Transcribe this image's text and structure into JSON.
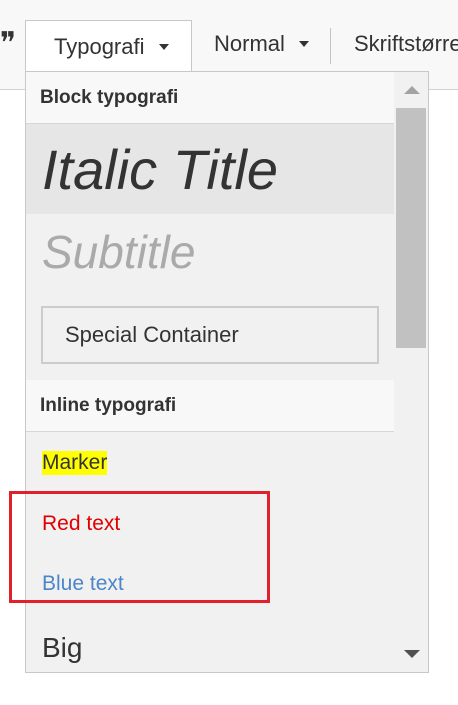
{
  "toolbar": {
    "quote_icon": "quote-icon",
    "styles_combo": "Typografi",
    "format_combo": "Normal",
    "font_size_combo": "Skriftstørrelse"
  },
  "dropdown": {
    "block_header": "Block typografi",
    "italic_title": "Italic Title",
    "subtitle": "Subtitle",
    "special_container": "Special Container",
    "inline_header": "Inline typografi",
    "marker": "Marker",
    "red_text": "Red text",
    "blue_text": "Blue text",
    "big": "Big"
  },
  "colors": {
    "marker_bg": "#ffff00",
    "red_text": "#e00000",
    "blue_text": "#4a86c8",
    "annotation": "#e0202a"
  }
}
